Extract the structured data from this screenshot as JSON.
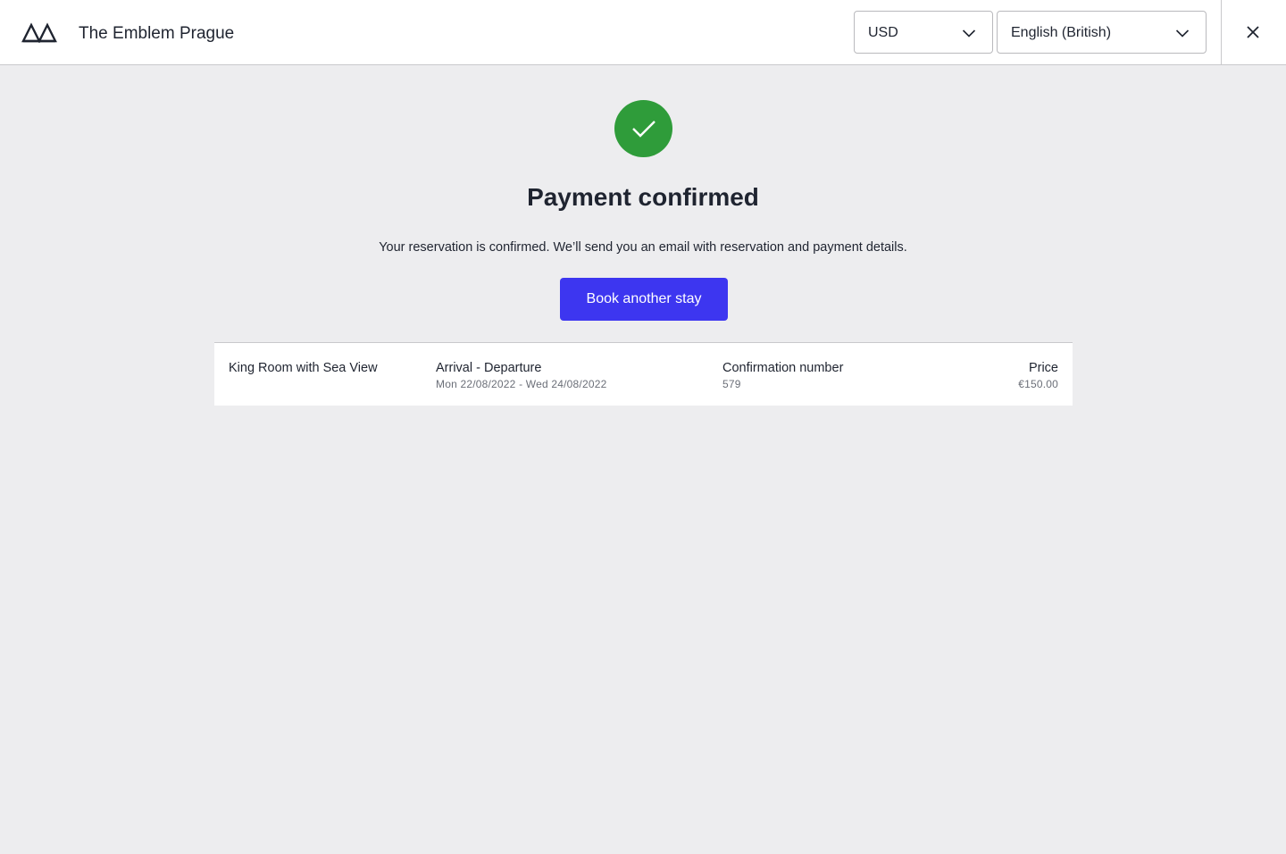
{
  "header": {
    "hotel_name": "The Emblem Prague",
    "currency": {
      "selected": "USD"
    },
    "language": {
      "selected": "English (British)"
    }
  },
  "confirmation": {
    "title": "Payment confirmed",
    "message": "Your reservation is confirmed. We’ll send you an email with reservation and payment details.",
    "book_another_label": "Book another stay"
  },
  "summary": {
    "room": "King Room with Sea View",
    "dates_label": "Arrival - Departure",
    "dates_value": "Mon 22/08/2022 - Wed 24/08/2022",
    "confirmation_label": "Confirmation number",
    "confirmation_value": "579",
    "price_label": "Price",
    "price_value": "€150.00"
  },
  "colors": {
    "accent": "#3d36f0",
    "success": "#2f9c3a",
    "background": "#ededef"
  },
  "icons": {
    "logo": "mountain-logo-icon",
    "dropdown": "chevron-down-icon",
    "close": "close-icon",
    "success": "checkmark-icon"
  }
}
